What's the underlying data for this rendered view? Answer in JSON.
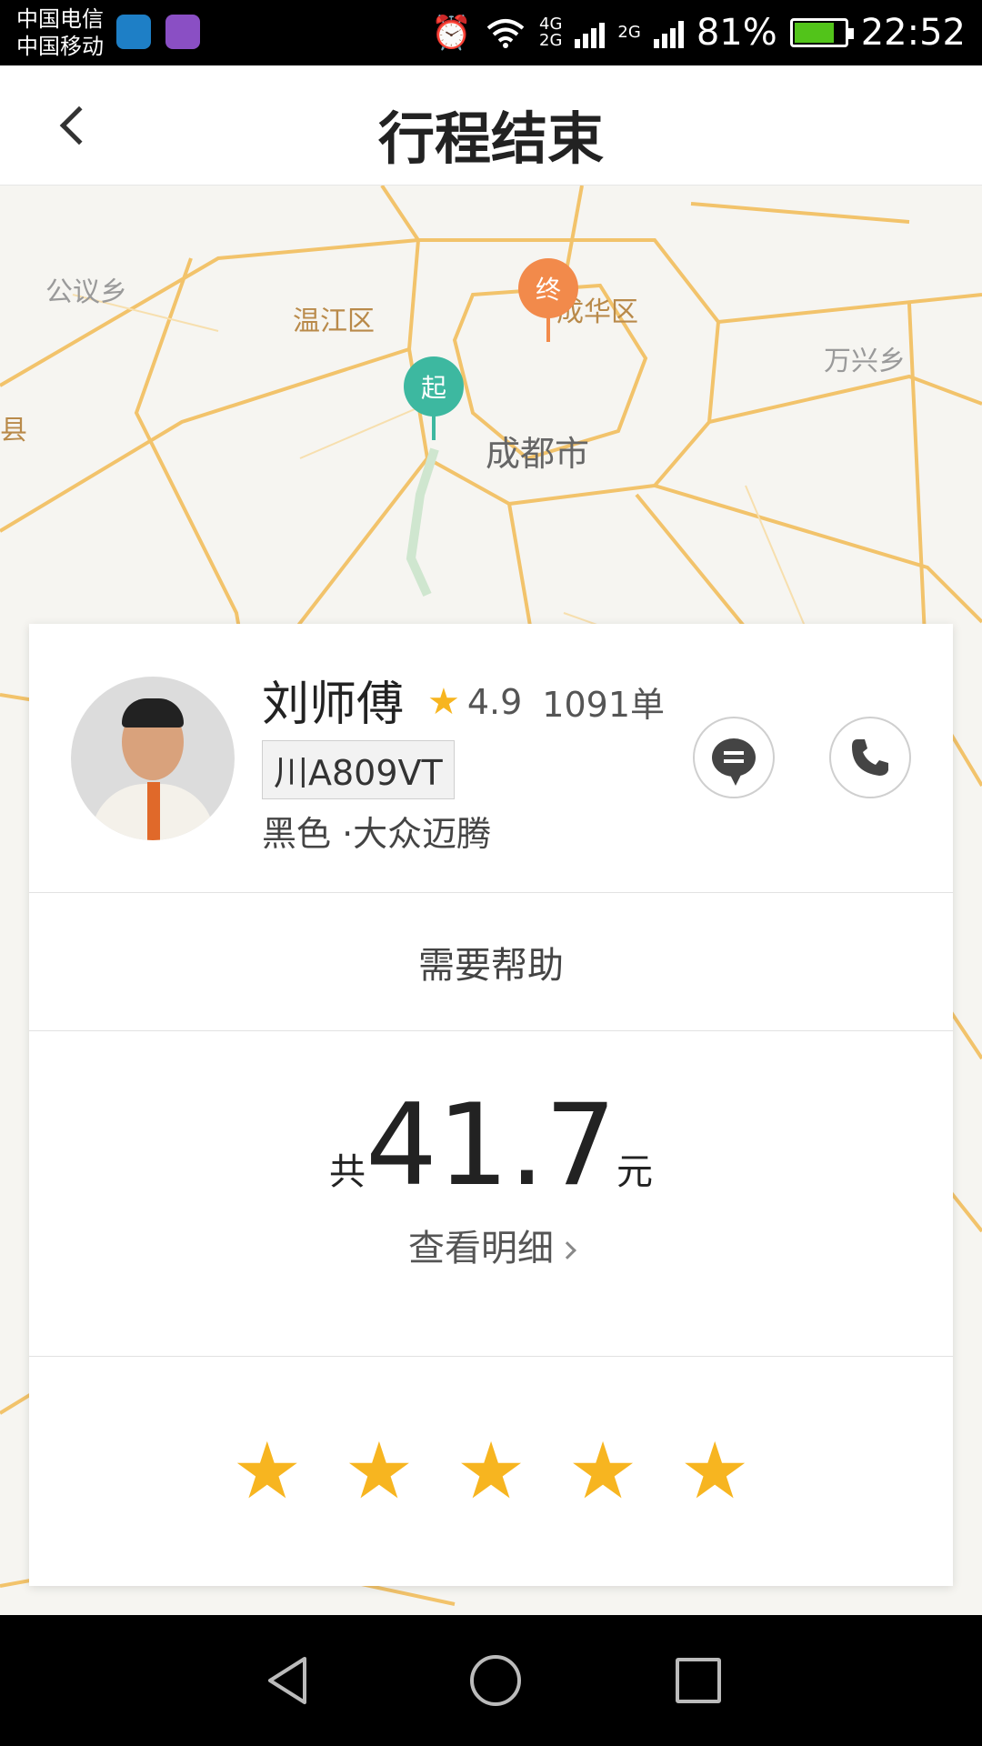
{
  "status_bar": {
    "carrier1": "中国电信",
    "carrier2": "中国移动",
    "net_a": "4G",
    "net_b": "2G",
    "net_c": "2G",
    "battery": "81%",
    "battery_level": 0.81,
    "time": "22:52"
  },
  "header": {
    "title": "行程结束"
  },
  "map": {
    "labels": {
      "gongyi": "公议乡",
      "wenjiang": "温江区",
      "chenghua": "成华区",
      "wanxing": "万兴乡",
      "chengdu": "成都市",
      "yixian": "邑县"
    },
    "pins": {
      "start": "起",
      "end": "终"
    }
  },
  "driver": {
    "name": "刘师傅",
    "rating": "4.9",
    "orders": "1091单",
    "plate": "川A809VT",
    "car": "黑色 ·大众迈腾"
  },
  "help": {
    "label": "需要帮助"
  },
  "fare": {
    "prefix": "共",
    "amount": "41.7",
    "suffix": "元",
    "detail_link": "查看明细"
  },
  "rating_stars": {
    "count": 5,
    "filled": 5
  },
  "colors": {
    "accent_star": "#f7b520",
    "start_pin": "#3db8a0",
    "end_pin": "#f28a4b",
    "road": "#f2c36b"
  }
}
